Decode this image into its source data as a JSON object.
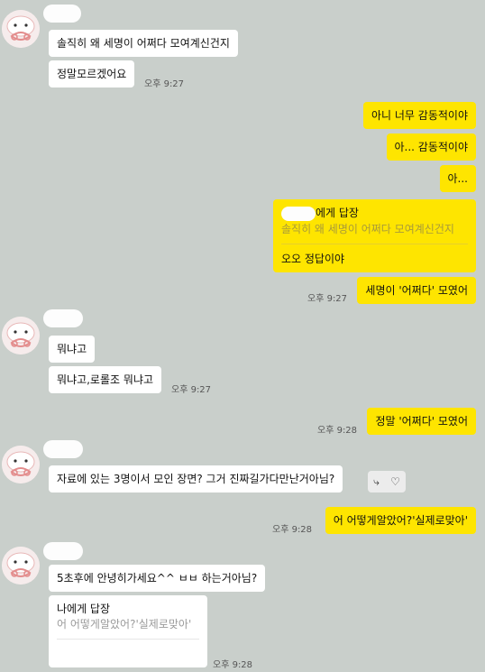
{
  "msgs": {
    "m1": "솔직히 왜 세명이 어쩌다 모여계신건지",
    "m2": "정말모르겠어요",
    "t1": "오후 9:27",
    "m3": "아니 너무 감동적이야",
    "m4": "아... 감동적이야",
    "m5": "아...",
    "r1_name": "에게 답장",
    "r1_quote": "솔직히 왜 세명이 어쩌다 모여계신건지",
    "r1_text": "오오 정답이야",
    "m6": "세명이 '어쩌다' 모였어",
    "t2": "오후 9:27",
    "m7": "뭐냐고",
    "m8": "뭐냐고,로롤조 뭐냐고",
    "t3": "오후 9:27",
    "m9": "정말 '어쩌다' 모였어",
    "t4": "오후 9:28",
    "m10": "자료에 있는 3명이서 모인 장면? 그거 진짜길가다만난거아님?",
    "m11": "어 어떻게알았어?'실제로맞아'",
    "t5": "오후 9:28",
    "m12": "5초후에 안녕히가세요^^ ㅂㅂ 하는거아님?",
    "r2_name": "나에게 답장",
    "r2_quote": "어 어떻게알았어?'실제로맞아'",
    "t6": "오후 9:28"
  },
  "icons": {
    "reply": "reply-arrow-icon",
    "like": "heart-icon",
    "avatar": "profile-character-icon"
  },
  "colors": {
    "background": "#c9cfcb",
    "incoming": "#ffffff",
    "outgoing": "#fee500"
  }
}
